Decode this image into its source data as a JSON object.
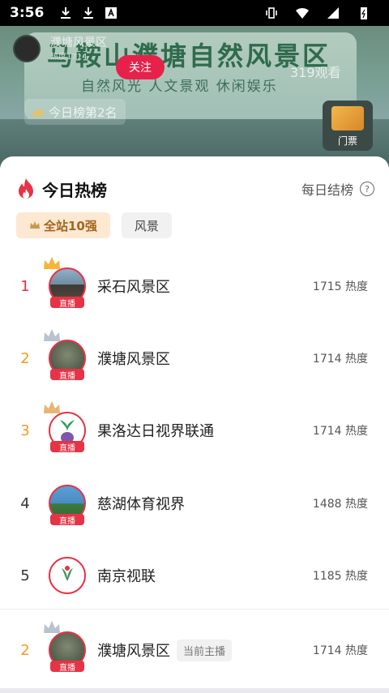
{
  "status_bar": {
    "time": "3:56"
  },
  "background": {
    "poster_title": "马鞍山濮塘自然风景区",
    "poster_subtitle": "自然风光 人文景观 休闲娱乐",
    "anchor_name": "濮塘风景区",
    "anchor_heat": "热度1714",
    "follow_label": "关注",
    "viewers": "319观看",
    "rank_chip": "今日榜第2名",
    "ticket_label": "门票"
  },
  "sheet": {
    "title": "今日热榜",
    "settle_label": "每日结榜",
    "tabs": [
      {
        "label": "全站10强"
      },
      {
        "label": "风景"
      }
    ],
    "live_tag": "直播",
    "rows": [
      {
        "rank": "1",
        "name": "采石风景区",
        "heat": "1715 热度"
      },
      {
        "rank": "2",
        "name": "濮塘风景区",
        "heat": "1714 热度"
      },
      {
        "rank": "3",
        "name": "果洛达日视界联通",
        "heat": "1714 热度"
      },
      {
        "rank": "4",
        "name": "慈湖体育视界",
        "heat": "1488 热度"
      },
      {
        "rank": "5",
        "name": "南京视联",
        "heat": "1185 热度"
      }
    ],
    "current": {
      "rank": "2",
      "name": "濮塘风景区",
      "tag": "当前主播",
      "heat": "1714 热度"
    }
  },
  "colors": {
    "live_red": "#e63346",
    "rank1": "#e82c3c",
    "rank_gold": "#f39a1c"
  }
}
